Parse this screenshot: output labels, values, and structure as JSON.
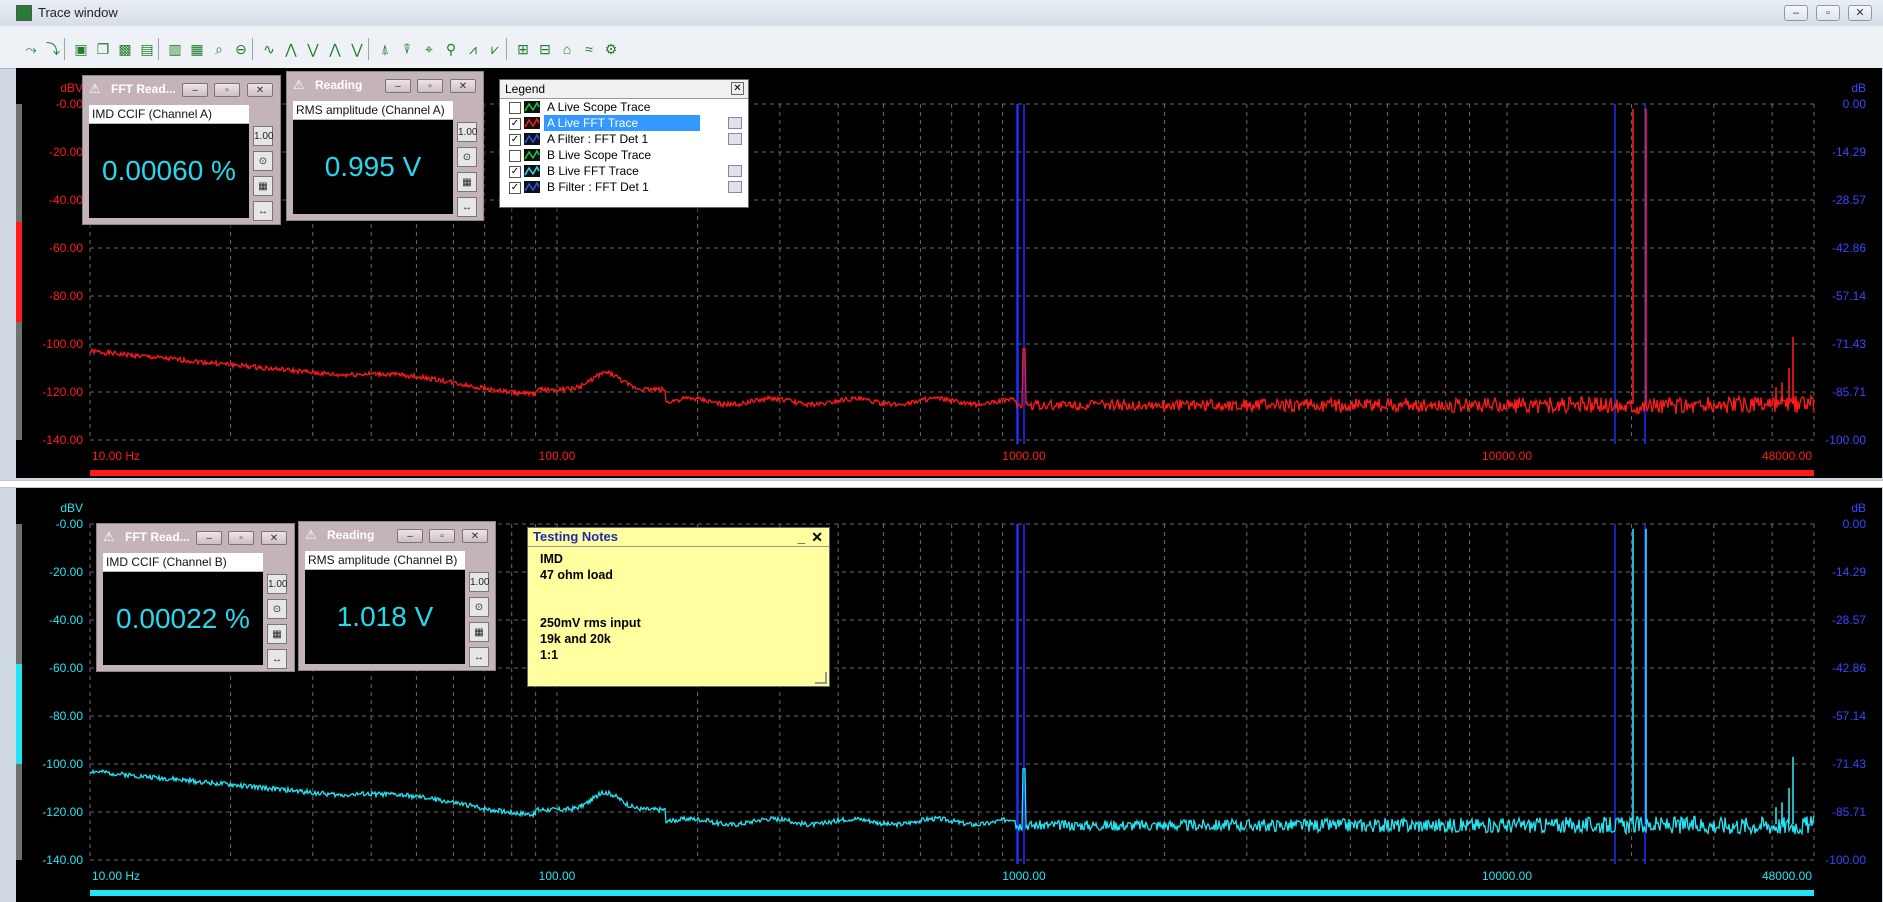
{
  "window": {
    "title": "Trace window"
  },
  "toolbar": {
    "icons": [
      "add-trace-icon",
      "remove-trace-icon",
      "save-icon",
      "copy-icon",
      "image-icon",
      "export-icon",
      "chart-icon",
      "grid-icon",
      "zoom-icon",
      "zoom-out-icon",
      "trace-icon",
      "cursor-a-icon",
      "cursor-b-icon",
      "cursor-c-icon",
      "cursor-d-icon",
      "peak-icon",
      "peak-next-icon",
      "marker-icon",
      "search-icon",
      "filter-icon",
      "filter2-icon",
      "gain-icon",
      "ratio-icon",
      "home-icon",
      "smooth-icon",
      "settings-icon"
    ]
  },
  "panels": [
    {
      "id": "A",
      "color": "#ff1a1a",
      "left_unit": "dBV",
      "right_unit": "dB",
      "left_ticks": [
        "-0.00",
        "-20.00",
        "-40.00",
        "-60.00",
        "-80.00",
        "-100.00",
        "-120.00",
        "-140.00"
      ],
      "right_ticks": [
        "0.00",
        "-14.29",
        "-28.57",
        "-42.86",
        "-57.14",
        "-71.43",
        "-85.71",
        "-100.00"
      ],
      "x_ticks": [
        "10.00 Hz",
        "100.00",
        "1000.00",
        "10000.00",
        "48000.00"
      ]
    },
    {
      "id": "B",
      "color": "#22e4f2",
      "left_unit": "dBV",
      "right_unit": "dB",
      "left_ticks": [
        "-0.00",
        "-20.00",
        "-40.00",
        "-60.00",
        "-80.00",
        "-100.00",
        "-120.00",
        "-140.00"
      ],
      "right_ticks": [
        "0.00",
        "-14.29",
        "-28.57",
        "-42.86",
        "-57.14",
        "-71.43",
        "-85.71",
        "-100.00"
      ],
      "x_ticks": [
        "10.00 Hz",
        "100.00",
        "1000.00",
        "10000.00",
        "48000.00"
      ]
    }
  ],
  "readouts": [
    {
      "title": "FFT Read...",
      "label": "IMD CCIF (Channel A)",
      "value": "0.00060 %"
    },
    {
      "title": "Reading",
      "label": "RMS amplitude (Channel A)",
      "value": "0.995 V"
    },
    {
      "title": "FFT Read...",
      "label": "IMD CCIF (Channel B)",
      "value": "0.00022 %"
    },
    {
      "title": "Reading",
      "label": "RMS amplitude (Channel B)",
      "value": "1.018 V"
    }
  ],
  "legend": {
    "title": "Legend",
    "items": [
      {
        "label": "A  Live Scope Trace",
        "checked": false,
        "color": "#21c93a"
      },
      {
        "label": "A  Live FFT Trace",
        "checked": true,
        "color": "#ff1a1a"
      },
      {
        "label": "A  Filter : FFT Det 1",
        "checked": true,
        "color": "#2b56ff"
      },
      {
        "label": "B  Live Scope Trace",
        "checked": false,
        "color": "#21c93a"
      },
      {
        "label": "B  Live FFT Trace",
        "checked": true,
        "color": "#22e4f2"
      },
      {
        "label": "B  Filter : FFT Det 1",
        "checked": true,
        "color": "#2b56ff"
      }
    ]
  },
  "notes": {
    "title": "Testing Notes",
    "body": "IMD\n47 ohm load\n\n\n250mV rms input\n19k and 20k\n1:1"
  }
}
